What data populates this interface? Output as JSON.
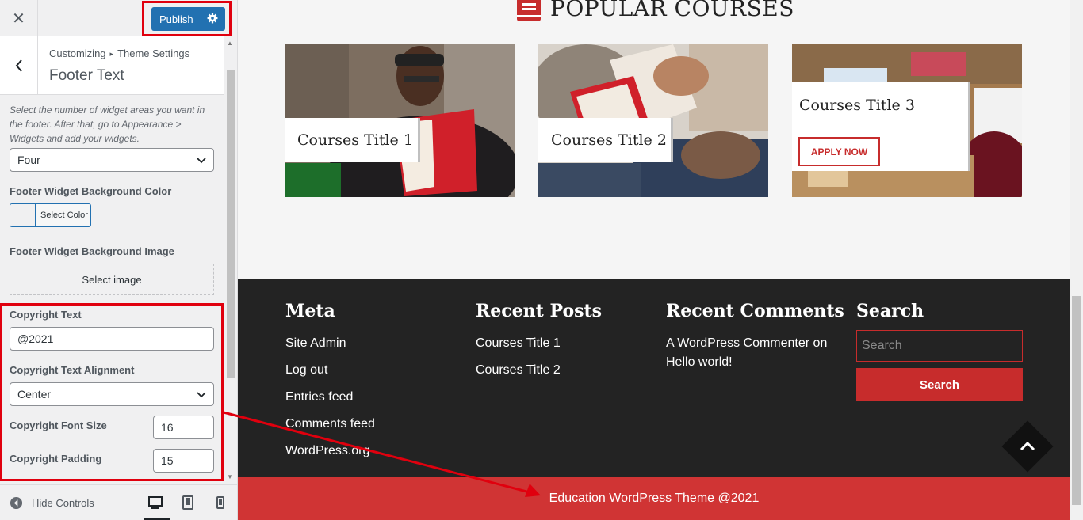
{
  "sidebar": {
    "close_icon": "close-icon",
    "publish_label": "Publish",
    "breadcrumb": {
      "parent": "Customizing",
      "separator": "▸",
      "current": "Theme Settings"
    },
    "section_title": "Footer Text",
    "widget_desc": "Select the number of widget areas you want in the footer. After that, go to Appearance > Widgets and add your widgets.",
    "widget_count": "Four",
    "bg_color_label": "Footer Widget Background Color",
    "select_color": "Select Color",
    "bg_image_label": "Footer Widget Background Image",
    "select_image": "Select image",
    "copyright_text_label": "Copyright Text",
    "copyright_text_value": "@2021",
    "alignment_label": "Copyright Text Alignment",
    "alignment_value": "Center",
    "font_size_label": "Copyright Font Size",
    "font_size_value": "16",
    "padding_label": "Copyright Padding",
    "padding_value": "15",
    "hide_controls": "Hide Controls",
    "devices": [
      "desktop-icon",
      "tablet-icon",
      "mobile-icon"
    ]
  },
  "preview": {
    "section_title": "POPULAR COURSES",
    "courses": [
      {
        "title": "Courses Title 1"
      },
      {
        "title": "Courses Title 2"
      },
      {
        "title": "Courses Title 3",
        "button": "APPLY NOW"
      }
    ],
    "footer": {
      "meta": {
        "heading": "Meta",
        "links": [
          "Site Admin",
          "Log out",
          "Entries feed",
          "Comments feed",
          "WordPress.org"
        ]
      },
      "recent_posts": {
        "heading": "Recent Posts",
        "links": [
          "Courses Title 1",
          "Courses Title 2"
        ]
      },
      "recent_comments": {
        "heading": "Recent Comments",
        "line1": "A WordPress Commenter on",
        "line2": "Hello world!"
      },
      "search": {
        "heading": "Search",
        "placeholder": "Search",
        "button": "Search"
      }
    },
    "copyright": "Education WordPress Theme @2021"
  },
  "colors": {
    "publish_blue": "#2271b1",
    "brand_red": "#c72c2c",
    "footer_dark": "#232323",
    "annotation_red": "#e0000e"
  }
}
